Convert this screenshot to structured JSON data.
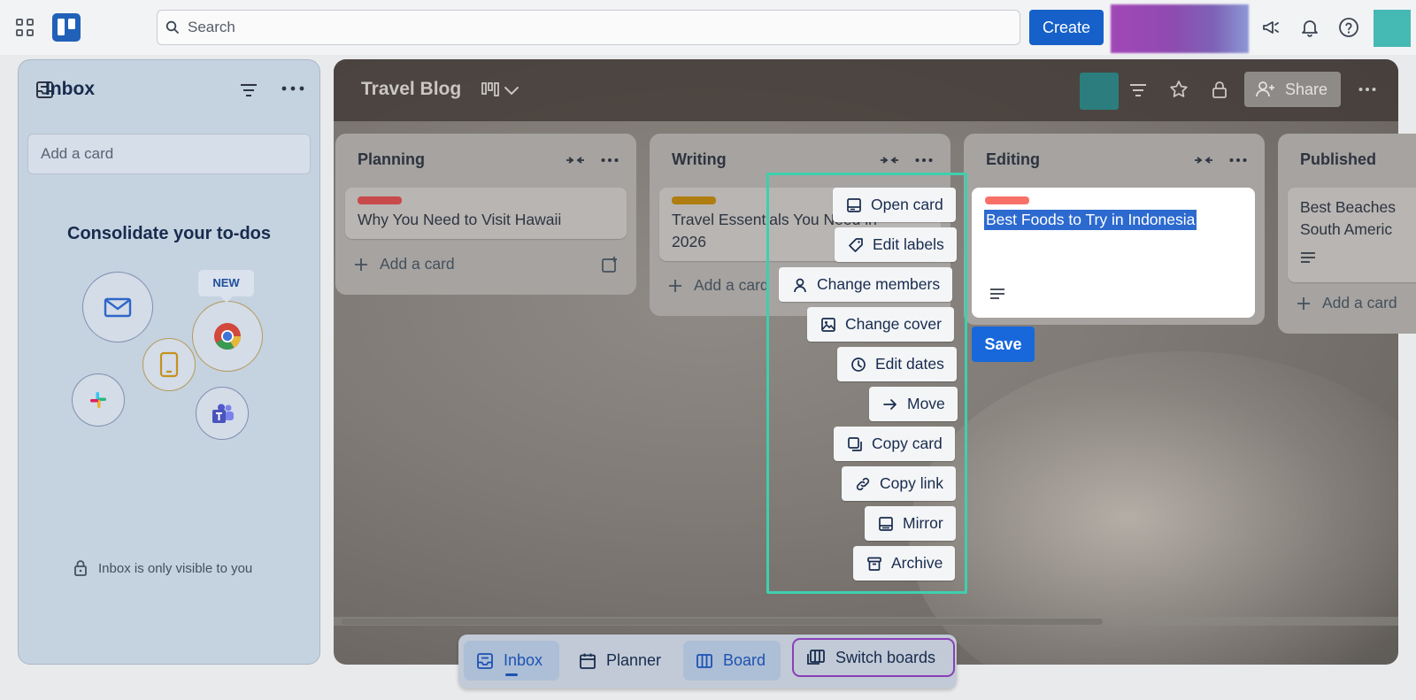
{
  "topbar": {
    "search_placeholder": "Search",
    "create_label": "Create"
  },
  "inbox": {
    "title": "Inbox",
    "add_card_placeholder": "Add a card",
    "promo_title": "Consolidate your to-dos",
    "new_badge": "NEW",
    "visibility_note": "Inbox is only visible to you"
  },
  "board": {
    "title": "Travel Blog",
    "share_label": "Share",
    "lists": [
      {
        "title": "Planning",
        "cards": [
          {
            "title": "Why You Need to Visit Hawaii",
            "label_color": "#c84a4a"
          }
        ],
        "add_label": "Add a card"
      },
      {
        "title": "Writing",
        "cards": [
          {
            "title_line1": "Travel Essentials You Need in",
            "title_line2": "2026",
            "label_color": "#b07d10"
          }
        ],
        "add_label": "Add a card"
      },
      {
        "title": "Editing",
        "editing_card": {
          "title": "Best Foods to Try in Indonesia",
          "label_color": "#f87168"
        },
        "save_label": "Save"
      },
      {
        "title": "Published",
        "cards": [
          {
            "title_line1": "Best Beaches",
            "title_line2": "South Americ"
          }
        ],
        "add_label": "Add a card"
      }
    ]
  },
  "quick_menu": {
    "items": [
      "Open card",
      "Edit labels",
      "Change members",
      "Change cover",
      "Edit dates",
      "Move",
      "Copy card",
      "Copy link",
      "Mirror",
      "Archive"
    ]
  },
  "bottom_nav": {
    "inbox": "Inbox",
    "planner": "Planner",
    "board": "Board",
    "switch_boards": "Switch boards"
  },
  "colors": {
    "accent": "#1868db",
    "menu_outline": "#3fcfae",
    "switch_outline": "#8a3fb8"
  }
}
